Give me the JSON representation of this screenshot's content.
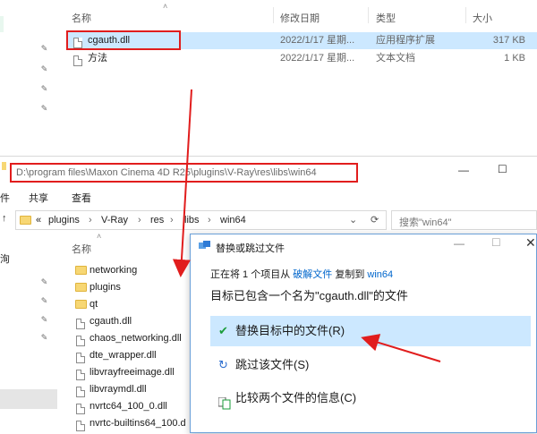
{
  "top_window": {
    "columns": {
      "name": "名称",
      "modified": "修改日期",
      "type": "类型",
      "size": "大小"
    },
    "files": [
      {
        "name": "cgauth.dll",
        "modified": "2022/1/17 星期...",
        "type": "应用程序扩展",
        "size": "317 KB"
      },
      {
        "name": "方法",
        "modified": "2022/1/17 星期...",
        "type": "文本文档",
        "size": "1 KB"
      }
    ]
  },
  "bottom_window": {
    "path": "D:\\program files\\Maxon Cinema 4D R25\\plugins\\V-Ray\\res\\libs\\win64",
    "ribbon": {
      "left": "件",
      "share": "共享",
      "view": "查看"
    },
    "breadcrumb": [
      "plugins",
      "V-Ray",
      "res",
      "libs",
      "win64"
    ],
    "breadcrumb_prefix": "«",
    "search_placeholder": "搜索\"win64\"",
    "name_header": "名称",
    "left_nav_fragment": "洵",
    "files": [
      {
        "name": "networking",
        "kind": "folder"
      },
      {
        "name": "plugins",
        "kind": "folder"
      },
      {
        "name": "qt",
        "kind": "folder"
      },
      {
        "name": "cgauth.dll",
        "kind": "file"
      },
      {
        "name": "chaos_networking.dll",
        "kind": "file"
      },
      {
        "name": "dte_wrapper.dll",
        "kind": "file"
      },
      {
        "name": "libvrayfreeimage.dll",
        "kind": "file"
      },
      {
        "name": "libvraymdl.dll",
        "kind": "file"
      },
      {
        "name": "nvrtc64_100_0.dll",
        "kind": "file"
      },
      {
        "name": "nvrtc-builtins64_100.d",
        "kind": "file"
      }
    ]
  },
  "dialog": {
    "title": "替换或跳过文件",
    "info": {
      "prefix": "正在将 1 个项目从",
      "source": "破解文件",
      "middle": "复制到",
      "dest": "win64"
    },
    "heading": "目标已包含一个名为\"cgauth.dll\"的文件",
    "options": [
      {
        "label": "替换目标中的文件(R)",
        "icon": "check-icon"
      },
      {
        "label": "跳过该文件(S)",
        "icon": "skip-icon"
      },
      {
        "label": "比较两个文件的信息(C)",
        "icon": "compare-icon"
      }
    ]
  },
  "colors": {
    "accent": "#e11d1d",
    "selection": "#cce8ff",
    "link": "#0066cc"
  }
}
